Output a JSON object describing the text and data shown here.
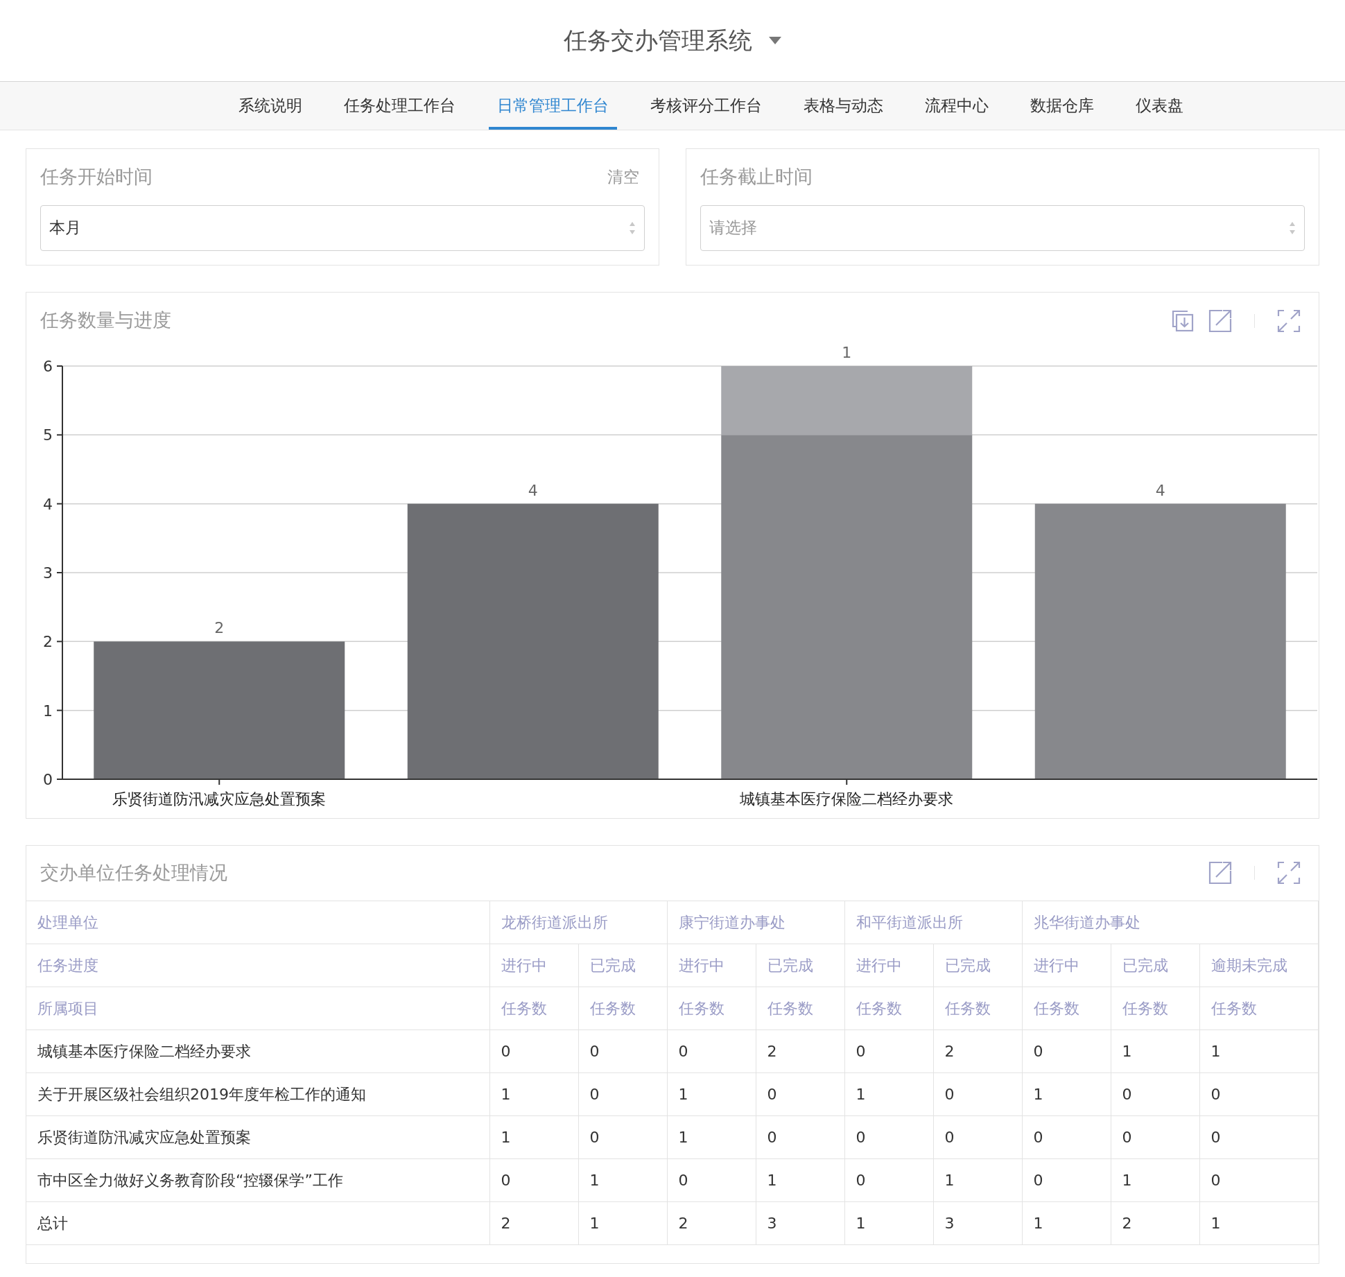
{
  "app_title": "任务交办管理系统",
  "nav_tabs": [
    {
      "label": "系统说明",
      "selected": false
    },
    {
      "label": "任务处理工作台",
      "selected": false
    },
    {
      "label": "日常管理工作台",
      "selected": true
    },
    {
      "label": "考核评分工作台",
      "selected": false
    },
    {
      "label": "表格与动态",
      "selected": false
    },
    {
      "label": "流程中心",
      "selected": false
    },
    {
      "label": "数据仓库",
      "selected": false
    },
    {
      "label": "仪表盘",
      "selected": false
    }
  ],
  "filters": [
    {
      "label": "任务开始时间",
      "clear": "清空",
      "value": "本月"
    },
    {
      "label": "任务截止时间",
      "placeholder": "请选择"
    }
  ],
  "chart_panel": {
    "title": "任务数量与进度",
    "chart_data": {
      "type": "bar",
      "stacked": true,
      "orientation": "vertical",
      "categories": [
        "乐贤街道防汛减灾应急处置预案",
        null,
        "城镇基本医疗保险二档经办要求",
        null
      ],
      "ylim": [
        0,
        6
      ],
      "yticks": [
        0,
        1,
        2,
        3,
        4,
        5,
        6
      ],
      "grid": true,
      "value_labels": [
        [
          "2",
          "4",
          null,
          null
        ],
        [
          null,
          null,
          null,
          "4"
        ],
        [
          null,
          null,
          "1",
          null
        ]
      ],
      "series": [
        {
          "color": "#6e6f73",
          "values": [
            2,
            4,
            null,
            null
          ]
        },
        {
          "color": "#87888c",
          "values": [
            null,
            null,
            5,
            4
          ]
        },
        {
          "color": "#a7a8ac",
          "values": [
            null,
            null,
            1,
            null
          ]
        }
      ]
    }
  },
  "table_panel": {
    "title": "交办单位任务处理情况",
    "unit_header": "处理单位",
    "progress_header": "任务进度",
    "project_header": "所属项目",
    "groups": [
      {
        "name": "龙桥街道派出所",
        "statuses": [
          {
            "label": "进行中",
            "metric": "任务数"
          },
          {
            "label": "已完成",
            "metric": "任务数"
          }
        ]
      },
      {
        "name": "康宁街道办事处",
        "statuses": [
          {
            "label": "进行中",
            "metric": "任务数"
          },
          {
            "label": "已完成",
            "metric": "任务数"
          }
        ]
      },
      {
        "name": "和平街道派出所",
        "statuses": [
          {
            "label": "进行中",
            "metric": "任务数"
          },
          {
            "label": "已完成",
            "metric": "任务数"
          }
        ]
      },
      {
        "name": "兆华街道办事处",
        "statuses": [
          {
            "label": "进行中",
            "metric": "任务数"
          },
          {
            "label": "已完成",
            "metric": "任务数"
          },
          {
            "label": "逾期未完成",
            "metric": "任务数"
          }
        ]
      }
    ],
    "rows": [
      {
        "project": "城镇基本医疗保险二档经办要求",
        "values": [
          "0",
          "0",
          "0",
          "2",
          "0",
          "2",
          "0",
          "1",
          "1"
        ]
      },
      {
        "project": "关于开展区级社会组织2019年度年检工作的通知",
        "values": [
          "1",
          "0",
          "1",
          "0",
          "1",
          "0",
          "1",
          "0",
          "0"
        ]
      },
      {
        "project": "乐贤街道防汛减灾应急处置预案",
        "values": [
          "1",
          "0",
          "1",
          "0",
          "0",
          "0",
          "0",
          "0",
          "0"
        ]
      },
      {
        "project": "市中区全力做好义务教育阶段“控辍保学”工作",
        "values": [
          "0",
          "1",
          "0",
          "1",
          "0",
          "1",
          "0",
          "1",
          "0"
        ]
      },
      {
        "project": "总计",
        "values": [
          "2",
          "1",
          "2",
          "3",
          "1",
          "3",
          "1",
          "2",
          "1"
        ]
      }
    ]
  }
}
